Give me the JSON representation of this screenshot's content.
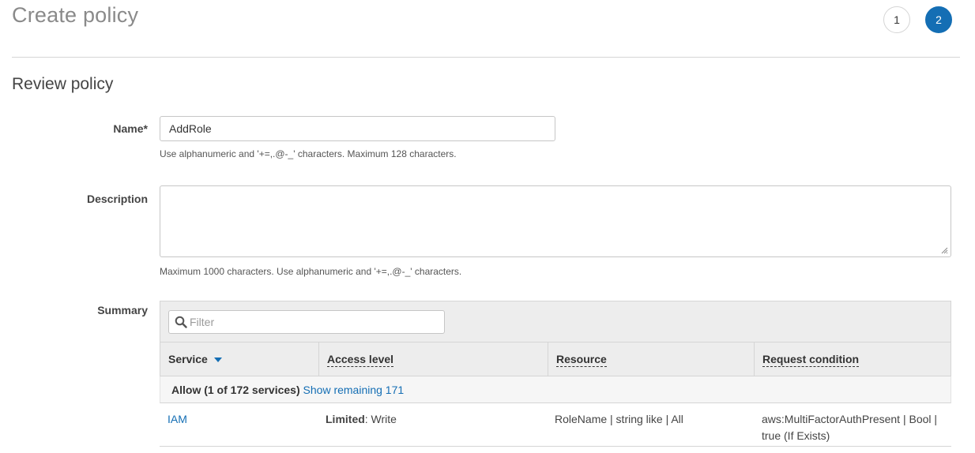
{
  "header": {
    "title": "Create policy",
    "steps": [
      "1",
      "2"
    ]
  },
  "section": {
    "title": "Review policy"
  },
  "form": {
    "name_label": "Name*",
    "name_value": "AddRole",
    "name_help": "Use alphanumeric and '+=,.@-_' characters. Maximum 128 characters.",
    "description_label": "Description",
    "description_value": "",
    "description_help": "Maximum 1000 characters. Use alphanumeric and '+=,.@-_' characters.",
    "summary_label": "Summary"
  },
  "summary": {
    "filter_placeholder": "Filter",
    "columns": [
      "Service",
      "Access level",
      "Resource",
      "Request condition"
    ],
    "allow_text": "Allow (1 of 172 services)",
    "show_remaining": "Show remaining 171",
    "rows": [
      {
        "service": "IAM",
        "access_bold": "Limited",
        "access_rest": ": Write",
        "resource": "RoleName | string like | All",
        "condition_line1": "aws:MultiFactorAuthPresent | Bool |",
        "condition_line2": "true (If Exists)"
      }
    ]
  },
  "colors": {
    "accent": "#146eb4",
    "header_bg": "#ededed"
  }
}
